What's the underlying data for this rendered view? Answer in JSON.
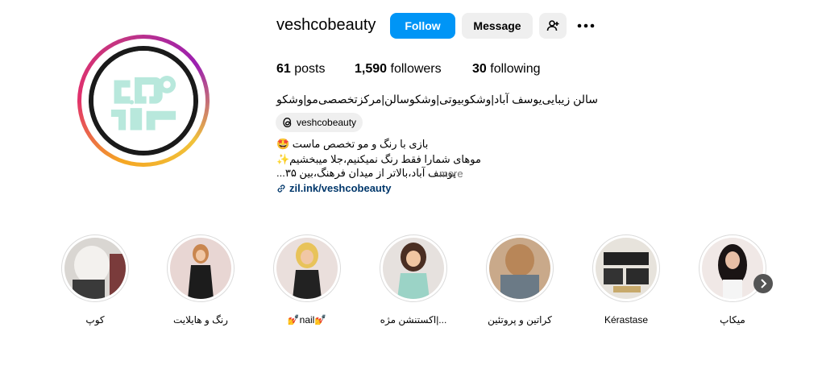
{
  "profile": {
    "username": "veshcobeauty",
    "follow_label": "Follow",
    "message_label": "Message",
    "stats": {
      "posts_count": "61",
      "posts_label": "posts",
      "followers_count": "1,590",
      "followers_label": "followers",
      "following_count": "30",
      "following_label": "following"
    },
    "bio_name": "سالن زیبایی‌یوسف آباد|وشکوبیوتی|وشکوسالن|مرکزتخصصی‌مو|وشکو",
    "threads_handle": "veshcobeauty",
    "bio_lines": [
      "بازی با رنگ و مو تخصص ماست 🤩",
      "موهای شمارا فقط رنگ نمیکنیم،جلا میبخشیم✨",
      "یوسف آباد،بالاتر از میدان فرهنگ،بین ۳۵..."
    ],
    "more_label": "more",
    "link": "zil.ink/veshcobeauty"
  },
  "highlights": [
    {
      "label": "کوپ"
    },
    {
      "label": "رنگ و هایلایت"
    },
    {
      "label": "💅nail💅"
    },
    {
      "label": "اکستنشن مژه|..."
    },
    {
      "label": "کراتین و پروتئین"
    },
    {
      "label": "Kérastase"
    },
    {
      "label": "میکاپ"
    }
  ],
  "colors": {
    "follow_button": "#0095f6",
    "secondary_button": "#efefef",
    "link": "#00376b",
    "logo_mint": "#b8e8dc"
  },
  "icons": {
    "add_user": "add-user-icon",
    "more": "more-horizontal-icon",
    "threads": "threads-icon",
    "link": "link-icon",
    "next": "chevron-right-icon"
  }
}
